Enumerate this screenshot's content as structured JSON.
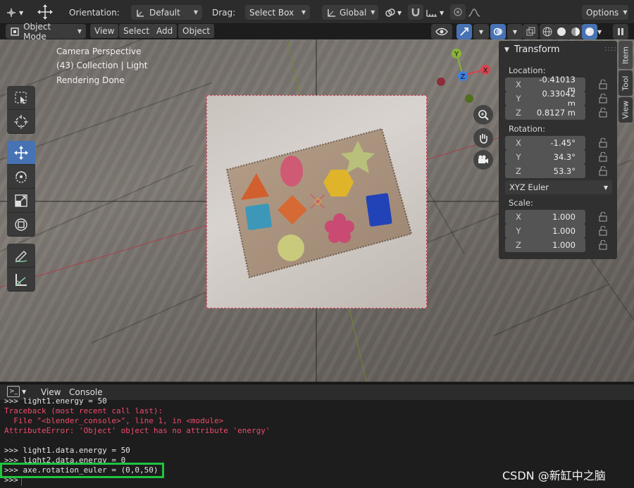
{
  "header": {
    "orientation_label": "Orientation:",
    "orientation_value": "Default",
    "drag_label": "Drag:",
    "drag_value": "Select Box",
    "transform_space": "Global",
    "options_label": "Options"
  },
  "header2": {
    "mode": "Object Mode",
    "menus": [
      "View",
      "Select",
      "Add",
      "Object"
    ]
  },
  "viewport": {
    "overlay_lines": [
      "Camera Perspective",
      "(43) Collection | Light",
      "Rendering Done"
    ],
    "gizmo": {
      "x": "X",
      "y": "Y",
      "z": "Z"
    }
  },
  "npanel": {
    "title": "Transform",
    "location_label": "Location:",
    "location": [
      {
        "axis": "X",
        "value": "-0.41013 m"
      },
      {
        "axis": "Y",
        "value": "0.33042 m"
      },
      {
        "axis": "Z",
        "value": "0.8127 m"
      }
    ],
    "rotation_label": "Rotation:",
    "rotation": [
      {
        "axis": "X",
        "value": "-1.45°"
      },
      {
        "axis": "Y",
        "value": "34.3°"
      },
      {
        "axis": "Z",
        "value": "53.3°"
      }
    ],
    "rotation_mode": "XYZ Euler",
    "scale_label": "Scale:",
    "scale": [
      {
        "axis": "X",
        "value": "1.000"
      },
      {
        "axis": "Y",
        "value": "1.000"
      },
      {
        "axis": "Z",
        "value": "1.000"
      }
    ],
    "tabs": [
      "Item",
      "Tool",
      "View"
    ]
  },
  "console": {
    "menus": [
      "View",
      "Console"
    ],
    "lines": [
      {
        "text": ">>> light1.energy = 50",
        "kind": "norm"
      },
      {
        "text": "Traceback (most recent call last):",
        "kind": "err"
      },
      {
        "text": "  File \"<blender_console>\", line 1, in <module>",
        "kind": "err"
      },
      {
        "text": "AttributeError: 'Object' object has no attribute 'energy'",
        "kind": "err"
      },
      {
        "text": "",
        "kind": "norm"
      },
      {
        "text": ">>> light1.data.energy = 50",
        "kind": "norm"
      },
      {
        "text": ">>> light2.data.energy = 0",
        "kind": "norm"
      },
      {
        "text": ">>> axe.rotation_euler = (0,0,50)",
        "kind": "norm"
      },
      {
        "text": ">>> ",
        "kind": "norm"
      }
    ]
  },
  "watermark": "CSDN @新缸中之脑",
  "colors": {
    "accent": "#4772b3",
    "highlight": "#21c43d",
    "error": "#f04a6c",
    "camera_frame": "#d0445a"
  }
}
